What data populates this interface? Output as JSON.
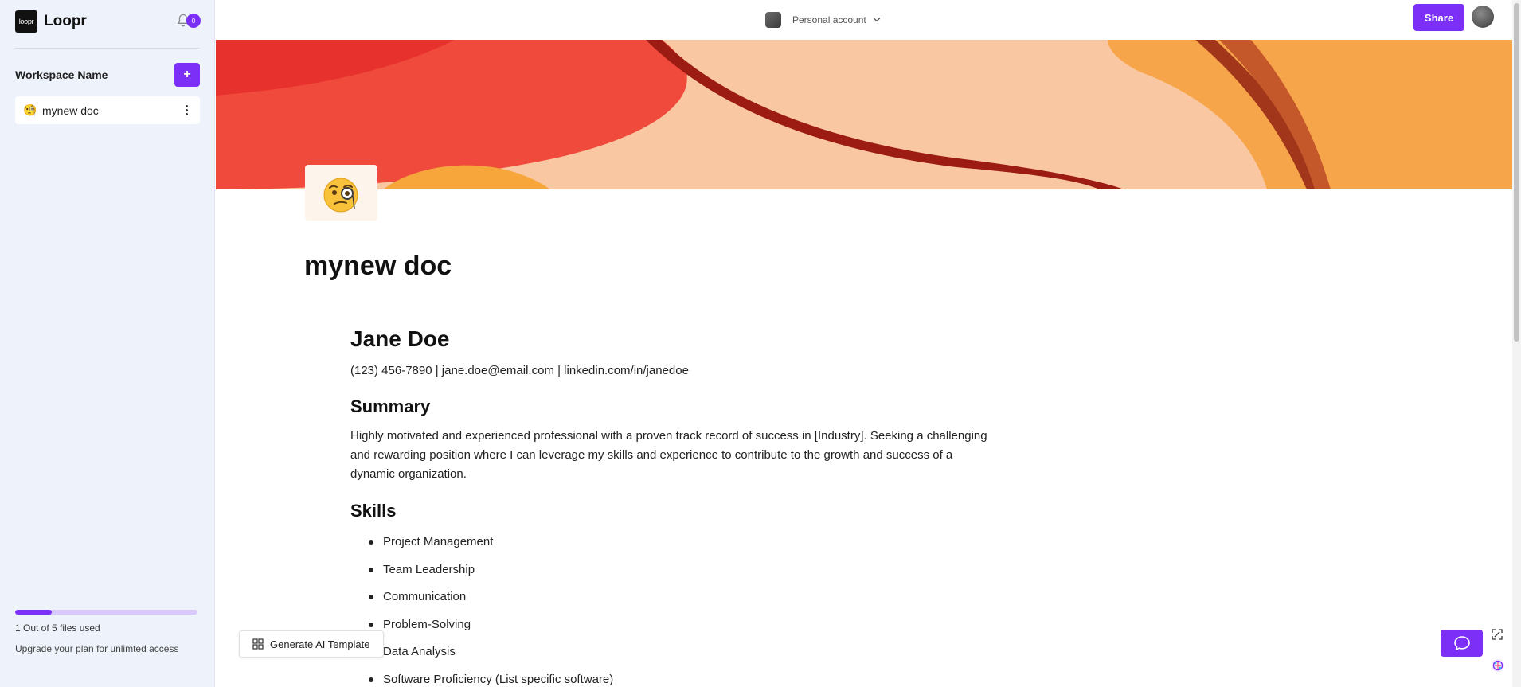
{
  "app": {
    "name": "Loopr",
    "logo_text": "loopr"
  },
  "sidebar": {
    "notification_count": "0",
    "workspace_name": "Workspace Name",
    "add_label": "+",
    "docs": [
      {
        "emoji": "🧐",
        "label": "mynew doc"
      }
    ],
    "usage": {
      "used": 1,
      "total": 5,
      "fraction": 0.2,
      "text": "1 Out of 5 files used"
    },
    "upgrade_text": "Upgrade your plan for unlimted access"
  },
  "topbar": {
    "account_label": "Personal account",
    "share_label": "Share"
  },
  "page": {
    "emoji": "🧐",
    "title": "mynew doc"
  },
  "document": {
    "name": "Jane Doe",
    "contact": "(123) 456-7890 | jane.doe@email.com | linkedin.com/in/janedoe",
    "summary_heading": "Summary",
    "summary": "Highly motivated and experienced professional with a proven track record of success in [Industry]. Seeking a challenging and rewarding position where I can leverage my skills and experience to contribute to the growth and success of a dynamic organization.",
    "skills_heading": "Skills",
    "skills": [
      "Project Management",
      "Team Leadership",
      "Communication",
      "Problem-Solving",
      "Data Analysis",
      "Software Proficiency (List specific software)"
    ]
  },
  "floating": {
    "generate_ai_label": "Generate AI Template"
  },
  "colors": {
    "accent": "#7b2ff7",
    "sidebar_bg": "#eef3fb"
  },
  "icons": {
    "bell": "bell-icon",
    "more": "more-vertical-icon",
    "chevron": "chevron-down-icon",
    "grid": "grid-icon",
    "chat": "chat-icon",
    "expand": "expand-icon",
    "brain": "brain-icon"
  }
}
